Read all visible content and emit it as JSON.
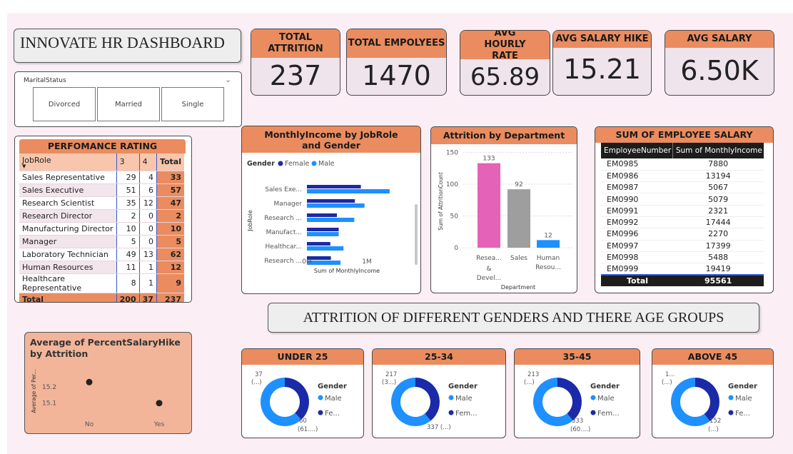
{
  "dashboard": {
    "title": "INNOVATE HR DASHBOARD",
    "section_title": "ATTRITION OF DIFFERENT GENDERS AND THERE AGE GROUPS"
  },
  "kpis": [
    {
      "label": "TOTAL ATTRITION",
      "value": "237"
    },
    {
      "label": "TOTAL EMPOLYEES",
      "value": "1470"
    },
    {
      "label": "AVG HOURLY RATE",
      "value": "65.89"
    },
    {
      "label": "AVG SALARY HIKE",
      "value": "15.21"
    },
    {
      "label": "AVG SALARY",
      "value": "6.50K"
    }
  ],
  "slicer": {
    "title": "MaritalStatus",
    "options": [
      "Divorced",
      "Married",
      "Single"
    ]
  },
  "performance": {
    "title": "PERFOMANCE RATING",
    "headers": [
      "JobRole",
      "3",
      "4",
      "Total"
    ],
    "rows": [
      {
        "role": "Sales Representative",
        "r3": "29",
        "r4": "4",
        "total": "33"
      },
      {
        "role": "Sales Executive",
        "r3": "51",
        "r4": "6",
        "total": "57"
      },
      {
        "role": "Research Scientist",
        "r3": "35",
        "r4": "12",
        "total": "47"
      },
      {
        "role": "Research Director",
        "r3": "2",
        "r4": "0",
        "total": "2"
      },
      {
        "role": "Manufacturing Director",
        "r3": "10",
        "r4": "0",
        "total": "10"
      },
      {
        "role": "Manager",
        "r3": "5",
        "r4": "0",
        "total": "5"
      },
      {
        "role": "Laboratory Technician",
        "r3": "49",
        "r4": "13",
        "total": "62"
      },
      {
        "role": "Human Resources",
        "r3": "11",
        "r4": "1",
        "total": "12"
      },
      {
        "role": "Healthcare Representative",
        "r3": "8",
        "r4": "1",
        "total": "9"
      }
    ],
    "total": {
      "role": "Total",
      "r3": "200",
      "r4": "37",
      "total": "237"
    }
  },
  "salary_table": {
    "title": "SUM OF EMPLOYEE SALARY",
    "headers": [
      "EmployeeNumber",
      "Sum of MonthlyIncome"
    ],
    "rows": [
      [
        "EM0985",
        "7880"
      ],
      [
        "EM0986",
        "13194"
      ],
      [
        "EM0987",
        "5067"
      ],
      [
        "EM0990",
        "5079"
      ],
      [
        "EM0991",
        "2321"
      ],
      [
        "EM0992",
        "17444"
      ],
      [
        "EM0996",
        "2270"
      ],
      [
        "EM0997",
        "17399"
      ],
      [
        "EM0998",
        "5488"
      ],
      [
        "EM0999",
        "19419"
      ]
    ],
    "total": [
      "Total",
      "95561"
    ]
  },
  "legend_labels": {
    "gender": "Gender",
    "female": "Female",
    "male": "Male",
    "fe_short": "Fe...",
    "fem_short": "Fem..."
  },
  "colors": {
    "accent": "#ea8c5f",
    "male": "#1e90ff",
    "female": "#1a2aa8",
    "pink_bg": "#fbeef5",
    "scatter_bg": "#f2b59a",
    "bar_pink": "#e462b7",
    "bar_gray": "#9e9e9e"
  },
  "chart_data": [
    {
      "type": "bar",
      "title": "MonthlyIncome by JobRole and Gender",
      "orientation": "horizontal",
      "categories": [
        "Sales Exe...",
        "Manager",
        "Research ...",
        "Manufact...",
        "Healthcar...",
        "Research ..."
      ],
      "series": [
        {
          "name": "Female",
          "values": [
            900000,
            800000,
            500000,
            530000,
            390000,
            400000
          ]
        },
        {
          "name": "Male",
          "values": [
            1380000,
            960000,
            790000,
            530000,
            610000,
            560000
          ]
        }
      ],
      "xlabel": "Sum of MonthlyIncome",
      "ylabel": "JobRole",
      "xticks": [
        "0M",
        "1M"
      ],
      "xlim": [
        0,
        1600000
      ],
      "legend": "top-left"
    },
    {
      "type": "bar",
      "title": "Attrition by Department",
      "categories": [
        "Resea... & Devel...",
        "Sales",
        "Human Resou..."
      ],
      "values": [
        133,
        92,
        12
      ],
      "xlabel": "Department",
      "ylabel": "Sum of AttritionCount",
      "yticks": [
        "0",
        "50",
        "100",
        "150"
      ],
      "ylim": [
        0,
        160
      ],
      "grid": true
    },
    {
      "type": "scatter",
      "title": "Average of PercentSalaryHike by Attrition",
      "categories": [
        "No",
        "Yes"
      ],
      "values": [
        15.23,
        15.1
      ],
      "ylabel": "Average of Per...",
      "yticks": [
        "15.2",
        "15.1"
      ],
      "ylim": [
        15.05,
        15.28
      ]
    },
    {
      "type": "pie",
      "title": "UNDER 25",
      "slices": [
        {
          "label": "Female",
          "value": 37
        },
        {
          "label": "Male",
          "value": 60
        }
      ],
      "labels_text": [
        "37",
        "(...)",
        "60",
        "(61....)"
      ],
      "legend_items": [
        "Male",
        "Fe..."
      ]
    },
    {
      "type": "pie",
      "title": "25-34",
      "slices": [
        {
          "label": "Female",
          "value": 217
        },
        {
          "label": "Male",
          "value": 337
        }
      ],
      "labels_text": [
        "217",
        "(3...)",
        "337 (...)"
      ],
      "legend_items": [
        "Male",
        "Fem..."
      ]
    },
    {
      "type": "pie",
      "title": "35-45",
      "slices": [
        {
          "label": "Female",
          "value": 213
        },
        {
          "label": "Male",
          "value": 333
        }
      ],
      "labels_text": [
        "213",
        "(...)",
        "333",
        "(60....)"
      ],
      "legend_items": [
        "Male",
        "Fem..."
      ]
    },
    {
      "type": "pie",
      "title": "ABOVE 45",
      "slices": [
        {
          "label": "Female",
          "value": 100
        },
        {
          "label": "Male",
          "value": 152
        }
      ],
      "labels_text": [
        "1...",
        "(...)",
        "152",
        "(...)"
      ],
      "legend_items": [
        "Male",
        "Fe..."
      ]
    }
  ]
}
